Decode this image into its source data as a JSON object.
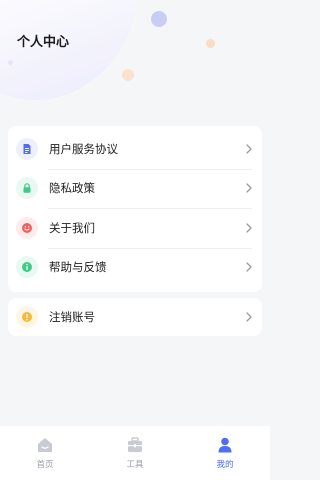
{
  "header": {
    "title": "个人中心"
  },
  "menu": {
    "items": [
      {
        "label": "用户服务协议",
        "icon": "document-icon",
        "color": "#4f6ef2",
        "bg": "#eef1fd"
      },
      {
        "label": "隐私政策",
        "icon": "lock-icon",
        "color": "#3fc98a",
        "bg": "#e9f8f1"
      },
      {
        "label": "关于我们",
        "icon": "smile-icon",
        "color": "#f06161",
        "bg": "#fdecec"
      },
      {
        "label": "帮助与反馈",
        "icon": "info-icon",
        "color": "#3fc98a",
        "bg": "#e9f8f1"
      }
    ],
    "danger_item": {
      "label": "注销账号",
      "icon": "warning-icon",
      "color": "#f6b93b",
      "bg": "#fef6e4"
    }
  },
  "tabbar": {
    "tabs": [
      {
        "label": "首页",
        "icon": "home-icon",
        "active": false
      },
      {
        "label": "工具",
        "icon": "toolbox-icon",
        "active": false
      },
      {
        "label": "我的",
        "icon": "user-icon",
        "active": true
      }
    ]
  },
  "colors": {
    "accent": "#4f6ef2",
    "inactive": "#9b9ea8",
    "background": "#f5f6f8"
  }
}
